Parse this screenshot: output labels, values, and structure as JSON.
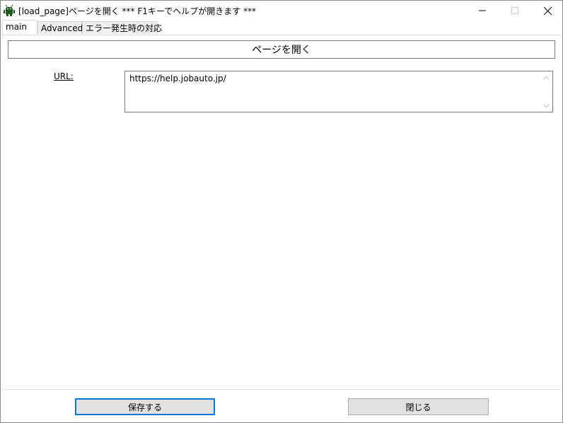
{
  "window": {
    "title": "[load_page]ページを開く *** F1キーでヘルプが開きます ***",
    "icon": "android-robot-icon",
    "controls": [
      "minimize-icon",
      "maximize-icon",
      "close-icon"
    ]
  },
  "tabs": [
    {
      "label": "main",
      "active": true
    },
    {
      "label": "Advanced",
      "active": false
    },
    {
      "label": "エラー発生時の対応",
      "active": false
    }
  ],
  "main": {
    "header": "ページを開く",
    "url_label": "URL:",
    "url_value": "https://help.jobauto.jp/"
  },
  "footer": {
    "save_label": "保存する",
    "close_label": "閉じる"
  },
  "colors": {
    "focus_border": "#0078d7",
    "button_face": "#e1e1e1"
  }
}
